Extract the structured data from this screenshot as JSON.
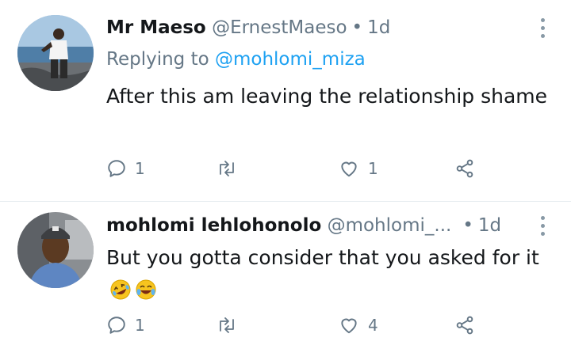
{
  "tweets": [
    {
      "name": "Mr Maeso",
      "handle": "@ErnestMaeso",
      "separator": "•",
      "time": "1d",
      "replying_prefix": "Replying to",
      "replying_to": "@mohlomi_miza",
      "text": "After this am leaving the relationship shame",
      "replies": "1",
      "retweets": "",
      "likes": "1"
    },
    {
      "name": "mohlomi lehlohonolo",
      "handle": "@mohlomi_...",
      "separator": "•",
      "time": "1d",
      "text": "But you gotta consider that you asked for it",
      "emojis": [
        "rolling-on-floor-laughing-emoji",
        "tears-of-joy-emoji"
      ],
      "replies": "1",
      "retweets": "",
      "likes": "4"
    }
  ],
  "icons": {
    "reply": "reply-icon",
    "retweet": "retweet-icon",
    "like": "heart-icon",
    "share": "share-icon",
    "more": "more-vertical-icon"
  },
  "colors": {
    "text": "#14171a",
    "secondary": "#657786",
    "link": "#1da1f2",
    "divider": "#e6ecf0"
  }
}
